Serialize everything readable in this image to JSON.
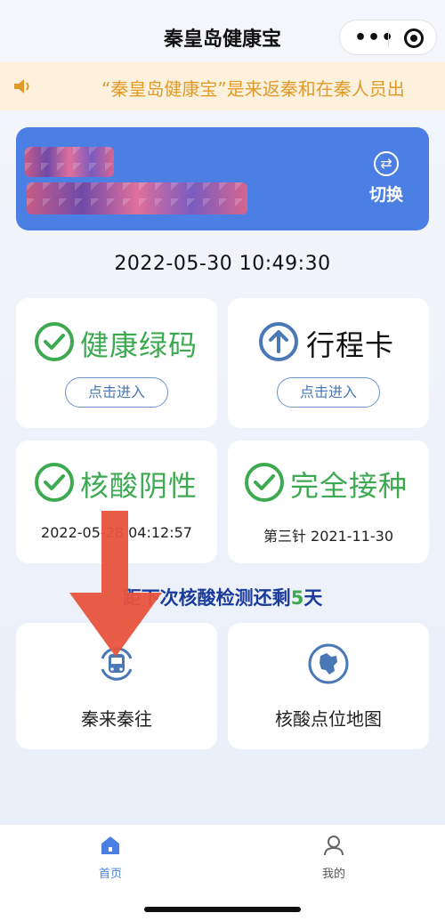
{
  "header": {
    "title": "秦皇岛健康宝"
  },
  "notice": {
    "text": "“秦皇岛健康宝”是来返秦和在秦人员出"
  },
  "user_card": {
    "switch_label": "切换",
    "switch_icon": "swap-arrows-icon"
  },
  "datetime": "2022-05-30 10:49:30",
  "cards": {
    "health_code": {
      "title": "健康绿码",
      "button": "点击进入",
      "icon": "check-circle-icon",
      "color": "#3daa52"
    },
    "trip_card": {
      "title": "行程卡",
      "button": "点击进入",
      "icon": "up-arrow-circle-icon",
      "color": "#4a77b5"
    },
    "nucleic": {
      "title": "核酸阴性",
      "sub": "2022-05-28 04:12:57",
      "icon": "check-circle-icon",
      "color": "#3daa52"
    },
    "vaccine": {
      "title": "完全接种",
      "sub": "第三针  2021-11-30",
      "icon": "check-circle-icon",
      "color": "#3daa52"
    }
  },
  "countdown": {
    "prefix": "距下次核酸检测还剩",
    "days": "5",
    "suffix": "天"
  },
  "services": [
    {
      "label": "秦来秦往",
      "icon": "bus-icon"
    },
    {
      "label": "核酸点位地图",
      "icon": "map-icon"
    }
  ],
  "tabbar": [
    {
      "label": "首页",
      "icon": "home-icon",
      "active": true
    },
    {
      "label": "我的",
      "icon": "user-icon",
      "active": false
    }
  ],
  "colors": {
    "accent": "#4c7fe3",
    "green": "#3daa52",
    "notice_bg": "#fbf1dd",
    "notice_text": "#e09a2a",
    "arrow": "#e8533d"
  }
}
